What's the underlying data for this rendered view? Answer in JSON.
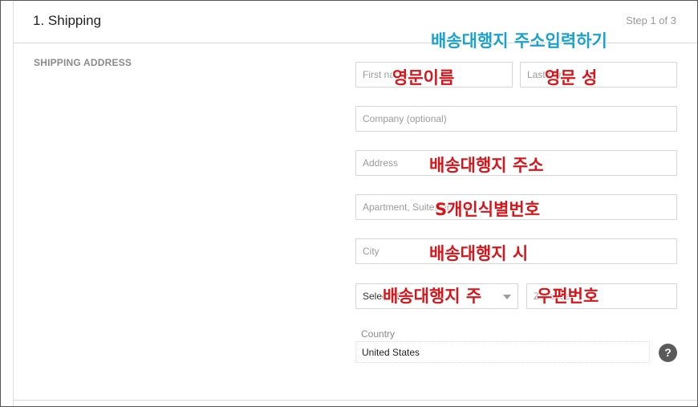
{
  "header": {
    "title": "1. Shipping",
    "step": "Step 1 of 3"
  },
  "section_label": "SHIPPING ADDRESS",
  "fields": {
    "first_name": "First name",
    "last_name": "Last name",
    "company": "Company (optional)",
    "address": "Address",
    "apartment": "Apartment, Suite, Unit, etc.",
    "city": "City",
    "state": "Select state",
    "zip": "Zip code"
  },
  "country": {
    "label": "Country",
    "value": "United States"
  },
  "help_icon": "?",
  "annotations": {
    "heading": "배송대행지 주소입력하기",
    "first_name": "영문이름",
    "last_name": "영문 성",
    "address": "배송대행지 주소",
    "apartment": "S개인식별번호",
    "city": "배송대행지 시",
    "state": "배송대행지 주",
    "zip": "우편번호"
  },
  "colors": {
    "annotation_red": "#d6161b",
    "annotation_blue": "#1aa1cc"
  }
}
